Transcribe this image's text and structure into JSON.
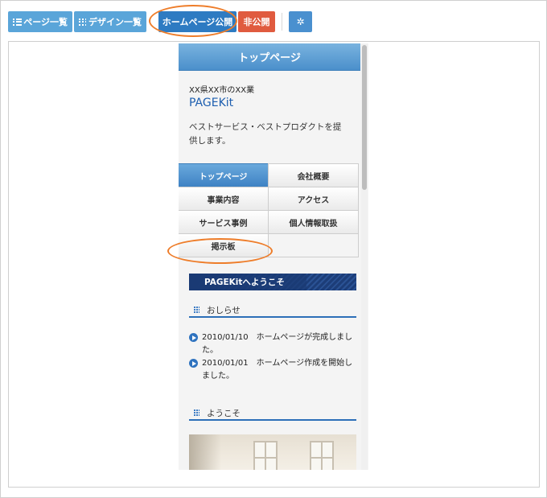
{
  "toolbar": {
    "pages_label": "ページ一覧",
    "design_label": "デザイン一覧",
    "publish_label": "ホームページ公開",
    "private_label": "非公開",
    "settings_icon": "gear-icon"
  },
  "colors": {
    "toolbar_blue": "#5aa5d9",
    "publish_blue": "#2e7bc2",
    "private_red": "#e05b3f",
    "highlight_orange": "#ee7d2a",
    "brand_blue": "#1e5fb0"
  },
  "mobile": {
    "header_title": "トップページ",
    "company": "XX県XX市のXX業",
    "brand": "PAGEKit",
    "description": "ベストサービス・ベストプロダクトを提供します。",
    "nav": [
      {
        "label": "トップページ"
      },
      {
        "label": "会社概要"
      },
      {
        "label": "事業内容"
      },
      {
        "label": "アクセス"
      },
      {
        "label": "サービス事例"
      },
      {
        "label": "個人情報取扱"
      },
      {
        "label": "掲示板"
      },
      {
        "label": ""
      }
    ],
    "banner": "PAGEKitへようこそ",
    "news_heading": "おしらせ",
    "news": [
      {
        "date": "2010/01/10",
        "text": "ホームページが完成しました。"
      },
      {
        "date": "2010/01/01",
        "text": "ホームページ作成を開始しました。"
      }
    ],
    "welcome_heading": "ようこそ"
  }
}
